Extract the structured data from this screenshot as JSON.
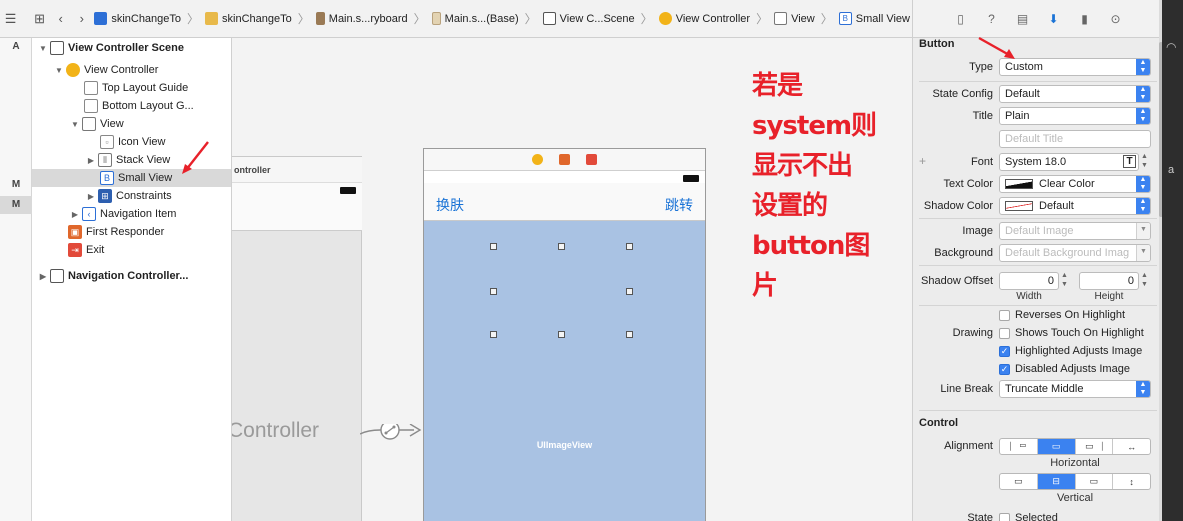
{
  "colors": {
    "accent": "#3b82f0",
    "annotation": "#e8212a",
    "image_view": "#a9c2e3"
  },
  "breadcrumb": [
    {
      "label": "skinChangeTo",
      "icon": "project-icon"
    },
    {
      "label": "skinChangeTo",
      "icon": "folder-icon"
    },
    {
      "label": "Main.s...ryboard",
      "icon": "storyboard-icon"
    },
    {
      "label": "Main.s...(Base)",
      "icon": "storyboard-icon"
    },
    {
      "label": "View C...Scene",
      "icon": "scene-icon"
    },
    {
      "label": "View Controller",
      "icon": "view-controller-icon"
    },
    {
      "label": "View",
      "icon": "view-icon"
    },
    {
      "label": "Small View",
      "icon": "button-icon"
    }
  ],
  "gutter": [
    "A",
    "M",
    "M"
  ],
  "outline": {
    "scene": "View Controller Scene",
    "view_controller": "View Controller",
    "top_guide": "Top Layout Guide",
    "bottom_guide": "Bottom Layout G...",
    "view": "View",
    "icon_view": "Icon View",
    "stack_view": "Stack View",
    "small_view": "Small View",
    "constraints": "Constraints",
    "navigation_item": "Navigation Item",
    "first_responder": "First Responder",
    "exit": "Exit",
    "nav_scene": "Navigation Controller..."
  },
  "canvas": {
    "nav_title": "ontroller",
    "nav_big": "Controller",
    "left_button": "换肤",
    "right_button": "跳转",
    "image_view_label": "UIImageView",
    "annotation": [
      "若是",
      "system则",
      "显示不出",
      "设置的",
      "button图",
      "片"
    ]
  },
  "inspector": {
    "section_button": "Button",
    "type_label": "Type",
    "type_value": "Custom",
    "state_label": "State Config",
    "state_value": "Default",
    "title_label": "Title",
    "title_value": "Plain",
    "title_placeholder": "Default Title",
    "font_label": "Font",
    "font_value": "System 18.0",
    "text_color_label": "Text Color",
    "text_color_value": "Clear Color",
    "shadow_color_label": "Shadow Color",
    "shadow_color_value": "Default",
    "image_label": "Image",
    "image_placeholder": "Default Image",
    "background_label": "Background",
    "background_placeholder": "Default Background Imag",
    "shadow_offset_label": "Shadow Offset",
    "shadow_w": "0",
    "shadow_h": "0",
    "width_caption": "Width",
    "height_caption": "Height",
    "drawing_label": "Drawing",
    "reverses": "Reverses On Highlight",
    "reverses_on": false,
    "shows_touch": "Shows Touch On Highlight",
    "shows_touch_on": false,
    "highlighted_adjusts": "Highlighted Adjusts Image",
    "highlighted_on": true,
    "disabled_adjusts": "Disabled Adjusts Image",
    "disabled_on": true,
    "line_break_label": "Line Break",
    "line_break_value": "Truncate Middle",
    "section_control": "Control",
    "alignment_label": "Alignment",
    "horizontal_caption": "Horizontal",
    "vertical_caption": "Vertical",
    "state_label2": "State",
    "selected_label": "Selected"
  }
}
